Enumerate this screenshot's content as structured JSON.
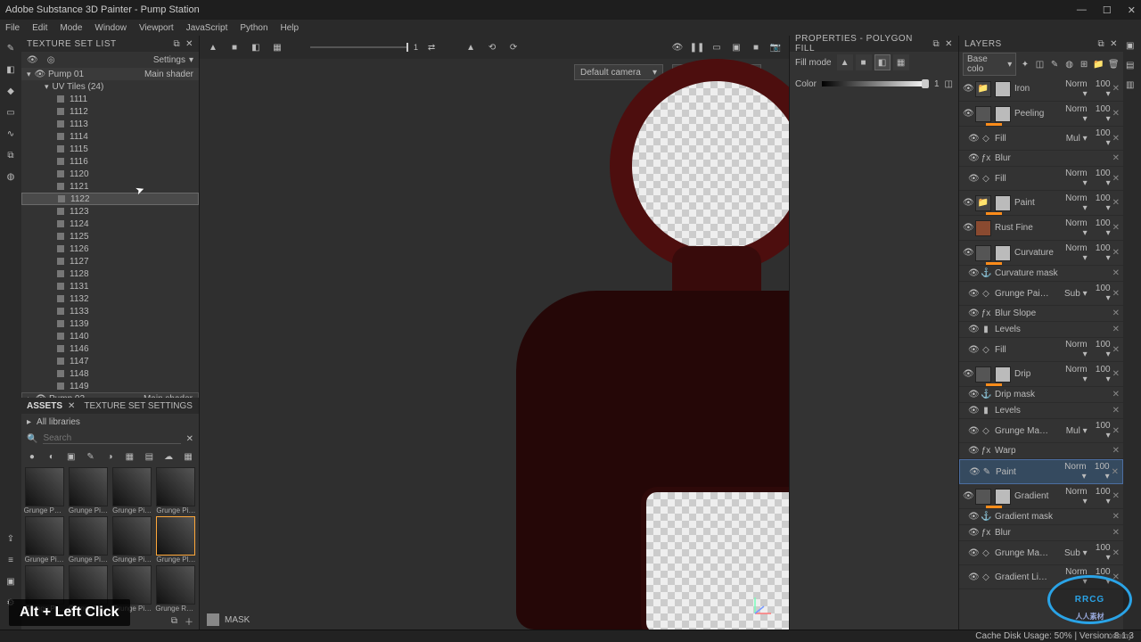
{
  "window": {
    "title": "Adobe Substance 3D Painter - Pump Station"
  },
  "menus": [
    "File",
    "Edit",
    "Mode",
    "Window",
    "Viewport",
    "JavaScript",
    "Python",
    "Help"
  ],
  "toolbar_left_icons": [
    "brush-icon",
    "eraser-icon",
    "projection-icon",
    "polyfill-icon",
    "smudge-icon",
    "clone-icon",
    "material-icon"
  ],
  "toolbar_left_icons2": [
    "export-icon",
    "bake-icon",
    "render-icon",
    "settings-icon"
  ],
  "texture_set_list": {
    "title": "TEXTURE SET LIST",
    "settings": "Settings",
    "pump01": "Pump 01",
    "pump02": "Pump 02",
    "shader": "Main shader",
    "uv_tiles": "UV Tiles (24)",
    "tiles": [
      "1111",
      "1112",
      "1113",
      "1114",
      "1115",
      "1116",
      "1120",
      "1121",
      "1122",
      "1123",
      "1124",
      "1125",
      "1126",
      "1127",
      "1128",
      "1131",
      "1132",
      "1133",
      "1139",
      "1140",
      "1146",
      "1147",
      "1148",
      "1149"
    ],
    "selected_tile": "1122"
  },
  "assets": {
    "tab1": "ASSETS",
    "tab2": "TEXTURE SET SETTINGS",
    "all_libraries": "All libraries",
    "search_placeholder": "Search",
    "thumbs": [
      "Grunge Pa…",
      "Grunge Pi…",
      "Grunge Pi…",
      "Grunge Pi…",
      "Grunge Pi…",
      "Grunge Pi…",
      "Grunge Pi…",
      "Grunge Pl…",
      "Grunge Pi…",
      "Grunge Pi…",
      "Grunge Pi…",
      "Grunge Ro…"
    ],
    "selected": 7
  },
  "viewport": {
    "camera": "Default camera",
    "channel": "Mask",
    "mask_label": "MASK"
  },
  "properties": {
    "title": "PROPERTIES - POLYGON FILL",
    "fill_mode": "Fill mode",
    "color": "Color",
    "color_val": "1"
  },
  "layers": {
    "title": "LAYERS",
    "channel": "Base colo",
    "items": [
      {
        "type": "folder",
        "name": "Iron",
        "blend": "Norm",
        "opa": "100"
      },
      {
        "type": "layer",
        "name": "Peeling",
        "blend": "Norm",
        "opa": "100",
        "bar": true
      },
      {
        "type": "sub",
        "name": "Fill",
        "blend": "Mul",
        "opa": "100",
        "icon": "fill"
      },
      {
        "type": "sub",
        "name": "Blur",
        "icon": "fx"
      },
      {
        "type": "sub",
        "name": "Fill",
        "blend": "Norm",
        "opa": "100",
        "icon": "fill"
      },
      {
        "type": "folder",
        "name": "Paint",
        "blend": "Norm",
        "opa": "100",
        "bar": true
      },
      {
        "type": "layer",
        "name": "Rust Fine",
        "blend": "Norm",
        "opa": "100",
        "rust": true
      },
      {
        "type": "layer",
        "name": "Curvature",
        "blend": "Norm",
        "opa": "100",
        "bar": true
      },
      {
        "type": "sub",
        "name": "Curvature mask",
        "icon": "anchor"
      },
      {
        "type": "sub",
        "name": "Grunge Pai…",
        "blend": "Sub",
        "opa": "100",
        "icon": "fill"
      },
      {
        "type": "sub",
        "name": "Blur Slope",
        "icon": "fx"
      },
      {
        "type": "sub",
        "name": "Levels",
        "icon": "levels"
      },
      {
        "type": "sub",
        "name": "Fill",
        "blend": "Norm",
        "opa": "100",
        "icon": "fill"
      },
      {
        "type": "layer",
        "name": "Drip",
        "blend": "Norm",
        "opa": "100",
        "bar": true
      },
      {
        "type": "sub",
        "name": "Drip mask",
        "icon": "anchor"
      },
      {
        "type": "sub",
        "name": "Levels",
        "icon": "levels"
      },
      {
        "type": "sub",
        "name": "Grunge Ma…",
        "blend": "Mul",
        "opa": "100",
        "icon": "fill"
      },
      {
        "type": "sub",
        "name": "Warp",
        "icon": "fx"
      },
      {
        "type": "sub",
        "name": "Paint",
        "blend": "Norm",
        "opa": "100",
        "icon": "paint",
        "selected": true
      },
      {
        "type": "layer",
        "name": "Gradient",
        "blend": "Norm",
        "opa": "100",
        "bar": true
      },
      {
        "type": "sub",
        "name": "Gradient mask",
        "icon": "anchor"
      },
      {
        "type": "sub",
        "name": "Blur",
        "icon": "fx"
      },
      {
        "type": "sub",
        "name": "Grunge Ma…",
        "blend": "Sub",
        "opa": "100",
        "icon": "fill"
      },
      {
        "type": "sub",
        "name": "Gradient Li…",
        "blend": "Norm",
        "opa": "100",
        "icon": "fill"
      }
    ]
  },
  "status": {
    "cache": "Cache Disk Usage:   50% | Version: 8.1.3",
    "udemy": "udemy"
  },
  "keytip": "Alt + Left Click",
  "watermark": {
    "main": "RRCG",
    "sub": "人人素材"
  }
}
